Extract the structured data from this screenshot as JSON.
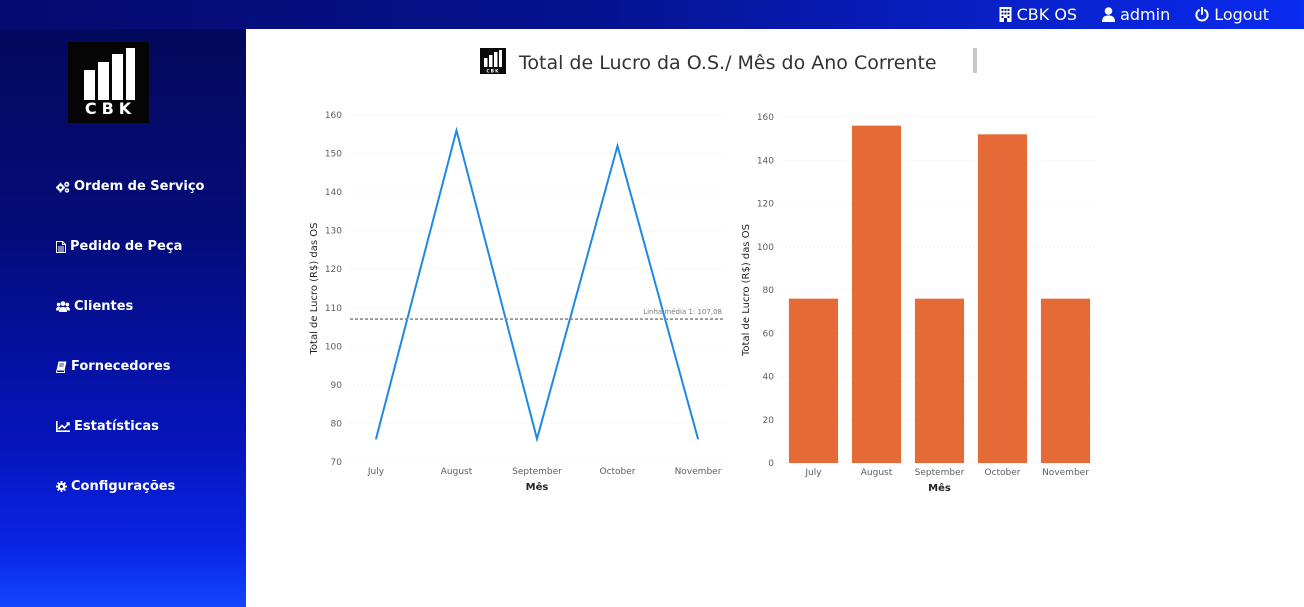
{
  "topnav": {
    "items": [
      {
        "label": "CBK OS",
        "icon": "building-icon"
      },
      {
        "label": "admin",
        "icon": "user-icon"
      },
      {
        "label": "Logout",
        "icon": "power-icon"
      }
    ]
  },
  "logo": {
    "text": "CBK"
  },
  "sidebar": {
    "items": [
      {
        "label": "Ordem de Serviço",
        "icon": "gears-icon"
      },
      {
        "label": "Pedido de Peça",
        "icon": "document-icon"
      },
      {
        "label": "Clientes",
        "icon": "users-icon"
      },
      {
        "label": "Fornecedores",
        "icon": "book-icon"
      },
      {
        "label": "Estatísticas",
        "icon": "line-chart-icon"
      },
      {
        "label": "Configurações",
        "icon": "gear-icon"
      }
    ]
  },
  "header": {
    "title": "Total de Lucro da O.S./ Mês do Ano Corrente",
    "icon": "cbk-logo-icon"
  },
  "colors": {
    "line": "#1e88e5",
    "bar": "#e46b38",
    "sidebar_top": "#03095c",
    "sidebar_bottom": "#1246ff"
  },
  "chart_data": [
    {
      "type": "line",
      "categories": [
        "July",
        "August",
        "September",
        "October",
        "November"
      ],
      "values": [
        76,
        156,
        76,
        152,
        76
      ],
      "xlabel": "Mês",
      "ylabel": "Total de Lucro (R$) das OS",
      "ylim": [
        70,
        160
      ],
      "yticks": [
        70,
        80,
        90,
        100,
        110,
        120,
        130,
        140,
        150,
        160
      ],
      "average_line": {
        "label": "Linha média 1: 107,08",
        "value": 107.08
      },
      "grid": true
    },
    {
      "type": "bar",
      "categories": [
        "July",
        "August",
        "September",
        "October",
        "November"
      ],
      "values": [
        76,
        156,
        76,
        152,
        76
      ],
      "xlabel": "Mês",
      "ylabel": "Total de Lucro (R$) das OS",
      "ylim": [
        0,
        160
      ],
      "yticks": [
        0,
        20,
        40,
        60,
        80,
        100,
        120,
        140,
        160
      ],
      "grid": true
    }
  ]
}
